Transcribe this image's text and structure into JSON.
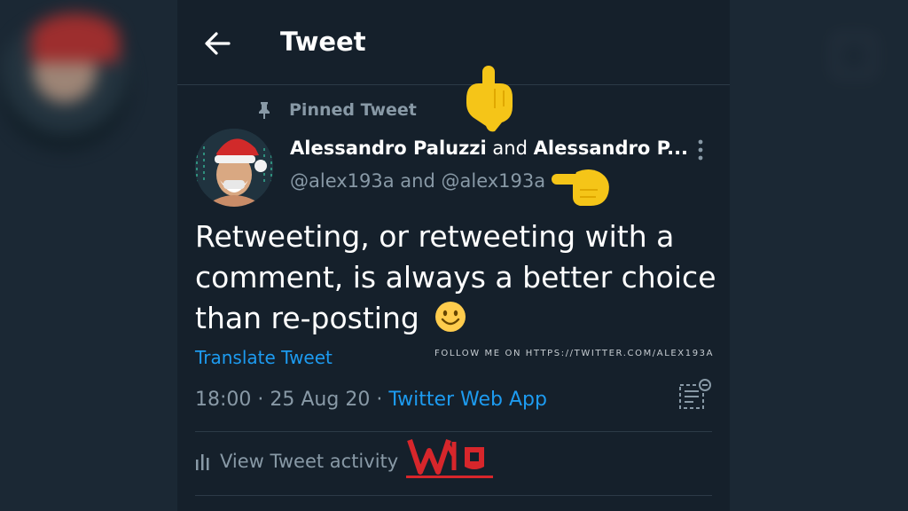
{
  "header": {
    "title": "Tweet"
  },
  "pinned_label": "Pinned Tweet",
  "author": {
    "name_1": "Alessandro Paluzzi",
    "and_1": "and",
    "name_2": "Alessandro P...",
    "handles": "@alex193a and @alex193a"
  },
  "tweet": {
    "text": "Retweeting, or retweeting with a comment, is always a better choice than re-posting",
    "emoji": "🙂"
  },
  "translate_label": "Translate Tweet",
  "watermark": "FOLLOW ME ON HTTPS://TWITTER.COM/ALEX193A",
  "meta": {
    "time": "18:00",
    "sep": " · ",
    "date": "25 Aug 20",
    "sep2": " · ",
    "source": "Twitter Web App"
  },
  "activity_label": "View Tweet activity",
  "colors": {
    "background": "#15202b",
    "accent": "#1d9bf0",
    "muted": "#8899a6",
    "logo_red": "#d7262b",
    "pointer_yellow": "#f5c518"
  },
  "icons": [
    "back-arrow-icon",
    "pin-icon",
    "more-icon",
    "smile-emoji",
    "notes-icon",
    "bars-icon",
    "pointing-down-hand-icon",
    "pointing-right-hand-icon",
    "wb-logo"
  ]
}
